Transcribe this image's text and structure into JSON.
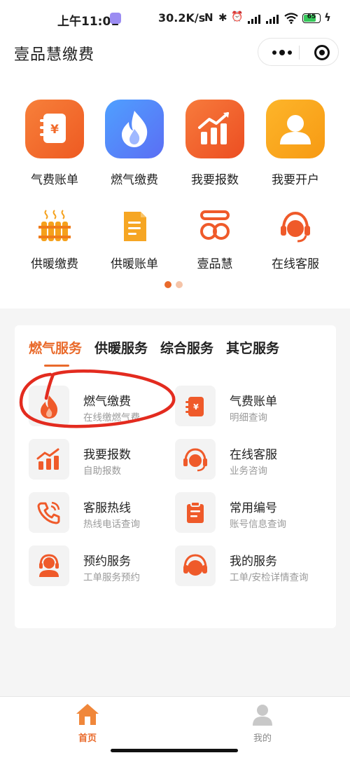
{
  "status_bar": {
    "time": "上午11:01",
    "network_speed": "30.2K/s",
    "nfc": "N",
    "bluetooth": "✱",
    "alarm": "⏰",
    "battery_level": "65",
    "charging": "ϟ"
  },
  "header": {
    "title": "壹品慧缴费"
  },
  "quick_grid": {
    "row1": [
      {
        "label": "气费账单",
        "icon": "bill-icon",
        "color": "#f36a2a"
      },
      {
        "label": "燃气缴费",
        "icon": "flame-icon",
        "color": "#5a86f6"
      },
      {
        "label": "我要报数",
        "icon": "chart-up-icon",
        "color": "#f0622e"
      },
      {
        "label": "我要开户",
        "icon": "user-icon",
        "color": "#f8a41a"
      }
    ],
    "row2": [
      {
        "label": "供暖缴费",
        "icon": "radiator-icon"
      },
      {
        "label": "供暖账单",
        "icon": "document-icon"
      },
      {
        "label": "壹品慧",
        "icon": "brand-logo-icon"
      },
      {
        "label": "在线客服",
        "icon": "headset-icon"
      }
    ],
    "pager": {
      "pages": 2,
      "active": 1
    }
  },
  "services": {
    "tabs": [
      {
        "label": "燃气服务",
        "active": true
      },
      {
        "label": "供暖服务",
        "active": false
      },
      {
        "label": "综合服务",
        "active": false
      },
      {
        "label": "其它服务",
        "active": false
      }
    ],
    "items": [
      {
        "name": "燃气缴费",
        "sub": "在线缴燃气费",
        "icon": "flame-icon"
      },
      {
        "name": "气费账单",
        "sub": "明细查询",
        "icon": "bill-icon"
      },
      {
        "name": "我要报数",
        "sub": "自助报数",
        "icon": "chart-up-icon"
      },
      {
        "name": "在线客服",
        "sub": "业务咨询",
        "icon": "headset-icon"
      },
      {
        "name": "客服热线",
        "sub": "热线电话查询",
        "icon": "phone-icon"
      },
      {
        "name": "常用编号",
        "sub": "账号信息查询",
        "icon": "clipboard-icon"
      },
      {
        "name": "预约服务",
        "sub": "工单服务预约",
        "icon": "agent-icon"
      },
      {
        "name": "我的服务",
        "sub": "工单/安检详情查询",
        "icon": "headphones-icon"
      }
    ]
  },
  "tabbar": {
    "home": {
      "label": "首页",
      "active": true
    },
    "mine": {
      "label": "我的",
      "active": false
    }
  },
  "colors": {
    "accent": "#e96a2b",
    "annotation": "#e32b1f"
  }
}
